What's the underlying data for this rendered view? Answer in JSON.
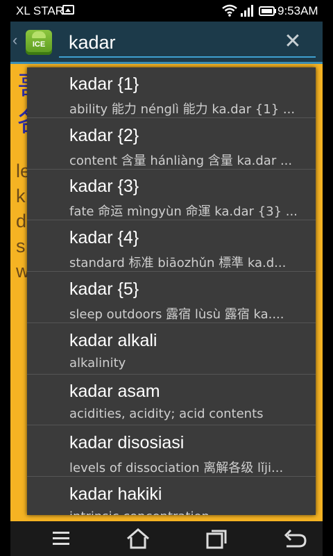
{
  "status_bar": {
    "carrier": "XL STAR",
    "time": "9:53AM",
    "icons": [
      "image-icon",
      "wifi-icon",
      "signal-icon",
      "battery-icon"
    ]
  },
  "action_bar": {
    "back_symbol": "‹",
    "app_icon_label": "ICE",
    "search_value": "kadar",
    "clear_symbol": "✕"
  },
  "background_content": {
    "heading": "哥\n各",
    "body": "le\nk\nd\ns\nw"
  },
  "suggestions": [
    {
      "title": "kadar {1}",
      "subtitle": "ability 能力 nénglì 能力 ka.dar {1} ..."
    },
    {
      "title": "kadar {2}",
      "subtitle": "content 含量 hánliàng 含量 ka.dar ..."
    },
    {
      "title": "kadar {3}",
      "subtitle": "fate 命运 mìngyùn 命運 ka.dar {3} ..."
    },
    {
      "title": "kadar {4}",
      "subtitle": "standard 标准 biāozhǔn 標準 ka.d..."
    },
    {
      "title": "kadar {5}",
      "subtitle": "sleep outdoors 露宿 lùsù 露宿 ka...."
    },
    {
      "title": "kadar alkali",
      "subtitle": "alkalinity"
    },
    {
      "title": "kadar asam",
      "subtitle": "acidities, acidity; acid contents"
    },
    {
      "title": "kadar disosiasi",
      "subtitle": "levels of dissociation 离解各级 lǐji..."
    },
    {
      "title": "kadar hakiki",
      "subtitle": "intrinsic concentration"
    }
  ],
  "nav_bar": {
    "icons": [
      "menu-icon",
      "home-icon",
      "recent-apps-icon",
      "back-icon"
    ]
  },
  "colors": {
    "action_bar": "#1c3a4a",
    "accent": "#3d8fb5",
    "content_bg": "#f5b323",
    "dropdown_bg": "#3b3b3b"
  }
}
